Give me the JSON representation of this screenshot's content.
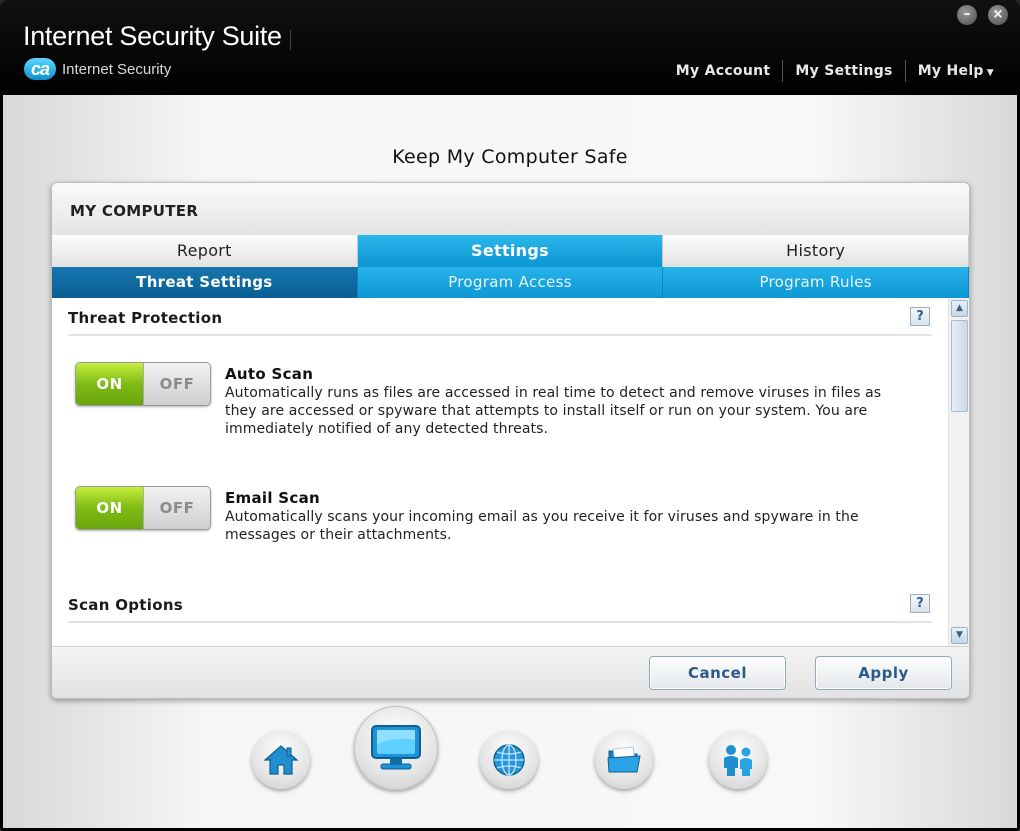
{
  "window": {
    "title": "Internet Security Suite",
    "brand_logo": "ca",
    "brand_text": "Internet Security",
    "minimize": "–",
    "close": "×"
  },
  "topnav": {
    "account": "My Account",
    "settings": "My Settings",
    "help": "My Help",
    "help_caret": "▼"
  },
  "page_heading": "Keep My Computer Safe",
  "panel": {
    "title": "MY COMPUTER",
    "tabs": [
      {
        "label": "Report",
        "active": false
      },
      {
        "label": "Settings",
        "active": true
      },
      {
        "label": "History",
        "active": false
      }
    ],
    "subtabs": [
      {
        "label": "Threat Settings",
        "active": true
      },
      {
        "label": "Program Access",
        "active": false
      },
      {
        "label": "Program Rules",
        "active": false
      }
    ]
  },
  "sections": {
    "threat_protection": {
      "title": "Threat Protection",
      "help": "?"
    },
    "scan_options": {
      "title": "Scan Options",
      "help": "?"
    }
  },
  "options": {
    "auto_scan": {
      "title": "Auto Scan",
      "description": "Automatically runs as files are accessed in real time to detect and remove viruses in files as they are accessed or spyware that attempts to install itself or run on your system. You are immediately notified of any detected threats.",
      "on_label": "ON",
      "off_label": "OFF",
      "state": "on"
    },
    "email_scan": {
      "title": "Email Scan",
      "description": "Automatically scans your incoming email as you receive it for viruses and spyware in the messages or their attachments.",
      "on_label": "ON",
      "off_label": "OFF",
      "state": "on"
    }
  },
  "scrollbar": {
    "up": "▲",
    "down": "▼"
  },
  "footer": {
    "cancel": "Cancel",
    "apply": "Apply"
  },
  "dock": [
    {
      "icon": "home-icon",
      "active": false
    },
    {
      "icon": "monitor-icon",
      "active": true
    },
    {
      "icon": "globe-icon",
      "active": false
    },
    {
      "icon": "folder-icon",
      "active": false
    },
    {
      "icon": "family-icon",
      "active": false
    }
  ],
  "colors": {
    "accent": "#0c95d2",
    "accent_dark": "#0a5f94",
    "toggle_on": "#7fba15",
    "header_bg": "#000000",
    "button_text": "#2c5a86"
  }
}
